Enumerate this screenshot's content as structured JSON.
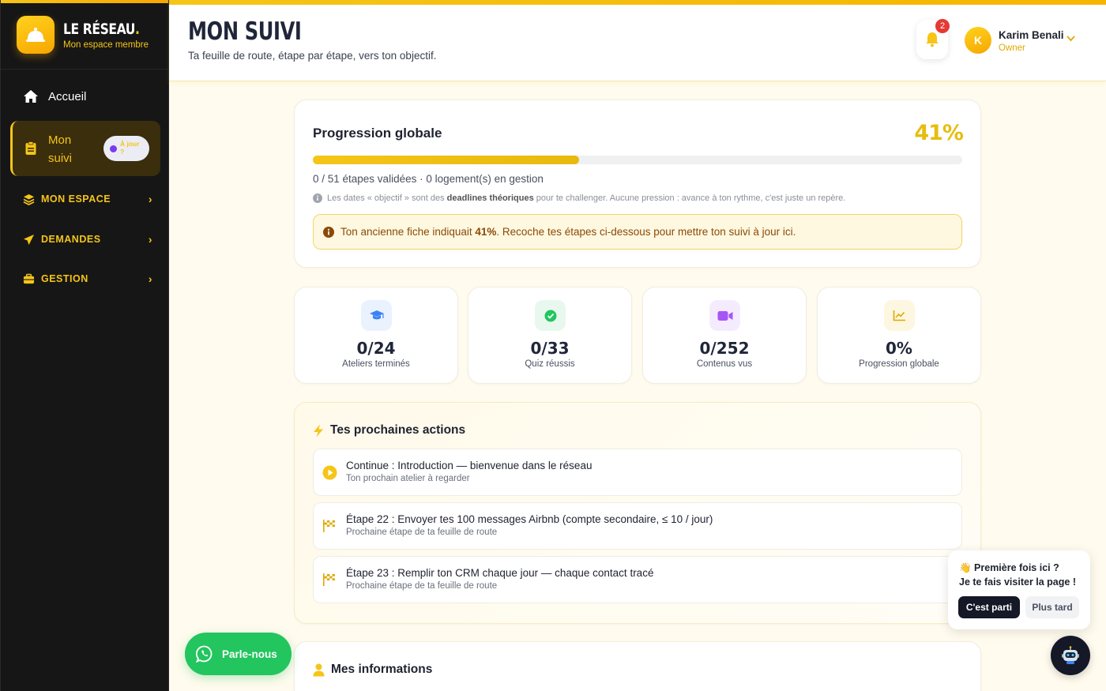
{
  "brand": {
    "title": "LE RÉSEAU",
    "title_dot": ".",
    "subtitle": "Mon espace membre"
  },
  "sidebar": {
    "home": "Accueil",
    "active": {
      "label": "Mon suivi",
      "toggle_text": "À jour ?"
    },
    "groups": [
      "MON ESPACE",
      "DEMANDES",
      "GESTION"
    ]
  },
  "header": {
    "title": "MON SUIVI",
    "subtitle": "Ta feuille de route, étape par étape, vers ton objectif.",
    "notifications": "2",
    "user": {
      "initial": "K",
      "name": "Karim Benali",
      "role": "Owner"
    }
  },
  "progress": {
    "title": "Progression globale",
    "percent_label": "41%",
    "percent": 0.41,
    "stats": "0 / 51 étapes validées · 0 logement(s) en gestion",
    "note_pre": "Les dates « objectif » sont des ",
    "note_bold": "deadlines théoriques",
    "note_post": " pour te challenger. Aucune pression : avance à ton rythme, c'est juste un repère.",
    "alert_pre": "Ton ancienne fiche indiquait ",
    "alert_bold": "41%",
    "alert_post": ". Recoche tes étapes ci-dessous pour mettre ton suivi à jour ici."
  },
  "stats": [
    {
      "value": "0/24",
      "label": "Ateliers terminés",
      "icon": "graduation-cap-icon",
      "color": "#3b82f6",
      "bg": "#eaf2fe"
    },
    {
      "value": "0/33",
      "label": "Quiz réussis",
      "icon": "check-circle-icon",
      "color": "#22c55e",
      "bg": "#e8f8ee"
    },
    {
      "value": "0/252",
      "label": "Contenus vus",
      "icon": "video-icon",
      "color": "#a855f7",
      "bg": "#f4ecfe"
    },
    {
      "value": "0%",
      "label": "Progression globale",
      "icon": "chart-line-icon",
      "color": "#e0a800",
      "bg": "#fdf6e0"
    }
  ],
  "actions": {
    "title": "Tes prochaines actions",
    "items": [
      {
        "title": "Continue : Introduction — bienvenue dans le réseau",
        "sub": "Ton prochain atelier à regarder"
      },
      {
        "title": "Étape 22 : Envoyer tes 100 messages Airbnb (compte secondaire, ≤ 10 / jour)",
        "sub": "Prochaine étape de ta feuille de route"
      },
      {
        "title": "Étape 23 : Remplir ton CRM chaque jour — chaque contact tracé",
        "sub": "Prochaine étape de ta feuille de route"
      }
    ]
  },
  "info": {
    "title": "Mes informations"
  },
  "whatsapp": {
    "label": "Parle-nous"
  },
  "tour": {
    "line1": "👋 Première fois ici ?",
    "line2": "Je te fais visiter la page !",
    "go": "C'est parti",
    "later": "Plus tard"
  }
}
